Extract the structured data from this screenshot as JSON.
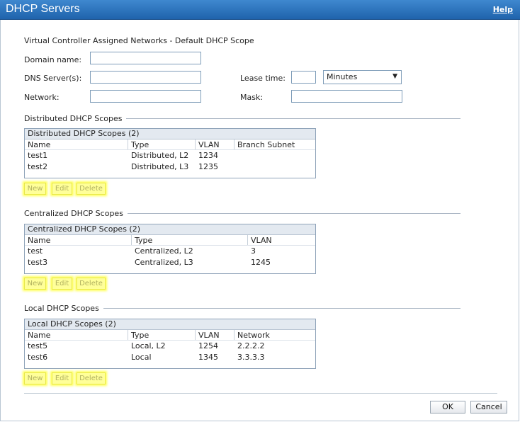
{
  "window": {
    "title": "DHCP Servers",
    "help_label": "Help"
  },
  "default_scope": {
    "heading": "Virtual Controller Assigned Networks - Default DHCP Scope",
    "domain_name_label": "Domain name:",
    "domain_name_value": "",
    "dns_label": "DNS Server(s):",
    "dns_value": "",
    "lease_label": "Lease time:",
    "lease_value": "",
    "lease_unit": "Minutes",
    "network_label": "Network:",
    "network_value": "",
    "mask_label": "Mask:",
    "mask_value": ""
  },
  "distributed": {
    "section_title": "Distributed DHCP Scopes",
    "table_caption": "Distributed DHCP Scopes (2)",
    "columns": [
      "Name",
      "Type",
      "VLAN",
      "Branch Subnet"
    ],
    "rows": [
      [
        "test1",
        "Distributed, L2",
        "1234",
        ""
      ],
      [
        "test2",
        "Distributed, L3",
        "1235",
        ""
      ]
    ]
  },
  "centralized": {
    "section_title": "Centralized DHCP Scopes",
    "table_caption": "Centralized DHCP Scopes (2)",
    "columns": [
      "Name",
      "Type",
      "VLAN"
    ],
    "rows": [
      [
        "test",
        "Centralized, L2",
        "3"
      ],
      [
        "test3",
        "Centralized, L3",
        "1245"
      ]
    ]
  },
  "local": {
    "section_title": "Local DHCP Scopes",
    "table_caption": "Local DHCP Scopes (2)",
    "columns": [
      "Name",
      "Type",
      "VLAN",
      "Network"
    ],
    "rows": [
      [
        "test5",
        "Local, L2",
        "1254",
        "2.2.2.2"
      ],
      [
        "test6",
        "Local",
        "1345",
        "3.3.3.3"
      ]
    ]
  },
  "actions": {
    "new_label": "New",
    "edit_label": "Edit",
    "delete_label": "Delete"
  },
  "footer": {
    "ok_label": "OK",
    "cancel_label": "Cancel"
  },
  "icons": {
    "dropdown_arrow": "chevron-down-icon"
  },
  "colors": {
    "titlebar": "#2b72bd",
    "highlight": "#ffff99",
    "table_header": "#e3e9f0"
  }
}
